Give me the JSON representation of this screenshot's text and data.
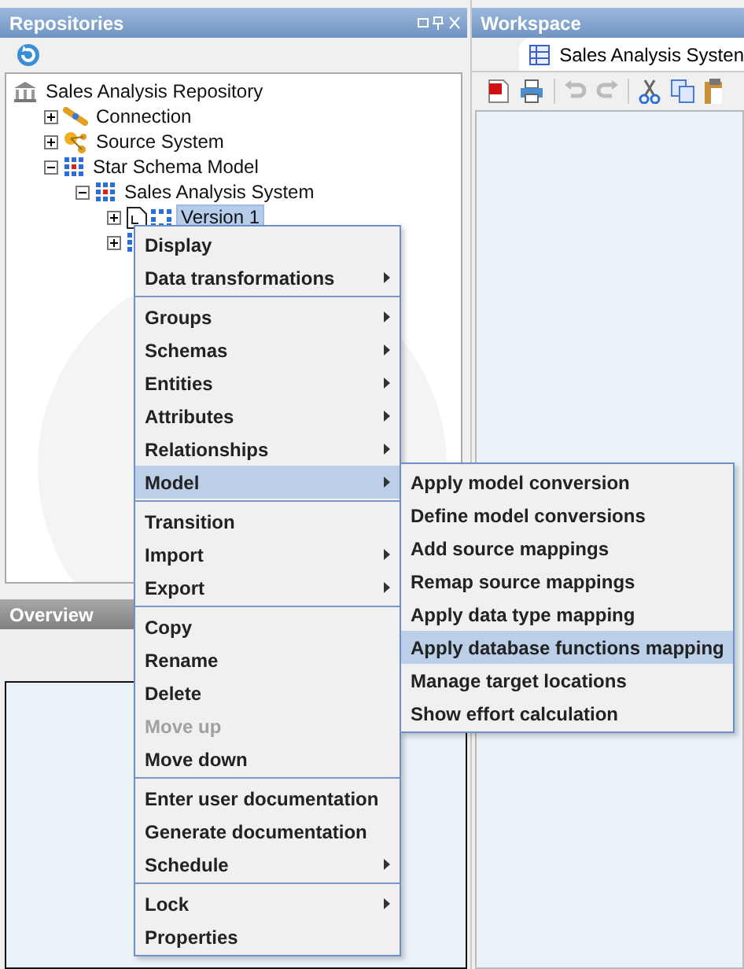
{
  "repositories": {
    "title": "Repositories",
    "tree": [
      {
        "label": "Sales Analysis Repository",
        "kind": "repository",
        "selected": false,
        "children": [
          {
            "label": "Connection",
            "kind": "connection",
            "expanded": false,
            "selected": false
          },
          {
            "label": "Source System",
            "kind": "source",
            "expanded": false,
            "selected": false
          },
          {
            "label": "Star Schema Model",
            "kind": "model",
            "expanded": true,
            "selected": false,
            "children": [
              {
                "label": "Sales Analysis System",
                "kind": "model",
                "expanded": true,
                "selected": false,
                "children": [
                  {
                    "label": "Version 1",
                    "kind": "version",
                    "expanded": false,
                    "selected": true
                  },
                  {
                    "kind": "model",
                    "expanded": false
                  }
                ]
              }
            ]
          }
        ]
      }
    ]
  },
  "overview": {
    "title": "Overview"
  },
  "workspace": {
    "title": "Workspace",
    "tab": {
      "label": "Sales Analysis Systen"
    }
  },
  "context_menu": {
    "items": [
      {
        "kind": "item",
        "label": "Display",
        "submenu": false,
        "disabled": false,
        "selected": false
      },
      {
        "kind": "item",
        "label": "Data transformations",
        "submenu": true,
        "disabled": false,
        "selected": false
      },
      {
        "kind": "separator"
      },
      {
        "kind": "item",
        "label": "Groups",
        "submenu": true,
        "disabled": false,
        "selected": false
      },
      {
        "kind": "item",
        "label": "Schemas",
        "submenu": true,
        "disabled": false,
        "selected": false
      },
      {
        "kind": "item",
        "label": "Entities",
        "submenu": true,
        "disabled": false,
        "selected": false
      },
      {
        "kind": "item",
        "label": "Attributes",
        "submenu": true,
        "disabled": false,
        "selected": false
      },
      {
        "kind": "item",
        "label": "Relationships",
        "submenu": true,
        "disabled": false,
        "selected": false
      },
      {
        "kind": "item",
        "label": "Model",
        "submenu": true,
        "disabled": false,
        "selected": true
      },
      {
        "kind": "separator"
      },
      {
        "kind": "item",
        "label": "Transition",
        "submenu": false,
        "disabled": false,
        "selected": false
      },
      {
        "kind": "item",
        "label": "Import",
        "submenu": true,
        "disabled": false,
        "selected": false
      },
      {
        "kind": "item",
        "label": "Export",
        "submenu": true,
        "disabled": false,
        "selected": false
      },
      {
        "kind": "separator"
      },
      {
        "kind": "item",
        "label": "Copy",
        "submenu": false,
        "disabled": false,
        "selected": false
      },
      {
        "kind": "item",
        "label": "Rename",
        "submenu": false,
        "disabled": false,
        "selected": false
      },
      {
        "kind": "item",
        "label": "Delete",
        "submenu": false,
        "disabled": false,
        "selected": false
      },
      {
        "kind": "item",
        "label": "Move up",
        "submenu": false,
        "disabled": true,
        "selected": false
      },
      {
        "kind": "item",
        "label": "Move down",
        "submenu": false,
        "disabled": false,
        "selected": false
      },
      {
        "kind": "separator"
      },
      {
        "kind": "item",
        "label": "Enter user documentation",
        "submenu": false,
        "disabled": false,
        "selected": false
      },
      {
        "kind": "item",
        "label": "Generate documentation",
        "submenu": false,
        "disabled": false,
        "selected": false
      },
      {
        "kind": "item",
        "label": "Schedule",
        "submenu": true,
        "disabled": false,
        "selected": false
      },
      {
        "kind": "separator"
      },
      {
        "kind": "item",
        "label": "Lock",
        "submenu": true,
        "disabled": false,
        "selected": false
      },
      {
        "kind": "item",
        "label": "Properties",
        "submenu": false,
        "disabled": false,
        "selected": false
      }
    ]
  },
  "submenu": {
    "items": [
      {
        "label": "Apply model conversion",
        "selected": false
      },
      {
        "label": "Define model conversions",
        "selected": false
      },
      {
        "label": "Add source mappings",
        "selected": false
      },
      {
        "label": "Remap source mappings",
        "selected": false
      },
      {
        "label": "Apply data type mapping",
        "selected": false
      },
      {
        "label": "Apply database functions mapping",
        "selected": true
      },
      {
        "label": "Manage target locations",
        "selected": false
      },
      {
        "label": "Show effort calculation",
        "selected": false
      }
    ]
  }
}
